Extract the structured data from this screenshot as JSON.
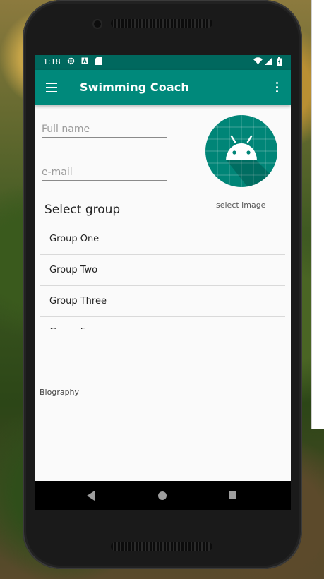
{
  "status_bar": {
    "time": "1:18",
    "icons": [
      "settings-icon",
      "a-icon",
      "sd-card-icon",
      "wifi-icon",
      "signal-icon",
      "battery-icon"
    ]
  },
  "app_bar": {
    "title": "Swimming Coach",
    "color": "#00897b"
  },
  "form": {
    "full_name": {
      "placeholder": "Full name",
      "value": ""
    },
    "email": {
      "placeholder": "e-mail",
      "value": ""
    },
    "select_group_label": "Select group",
    "groups": [
      "Group One",
      "Group Two",
      "Group Three",
      "Group Four"
    ],
    "select_image_label": "select image",
    "biography_label": "Biography"
  },
  "colors": {
    "status_bar": "#00685e",
    "accent": "#00897b",
    "avatar_bg": "#008577"
  }
}
